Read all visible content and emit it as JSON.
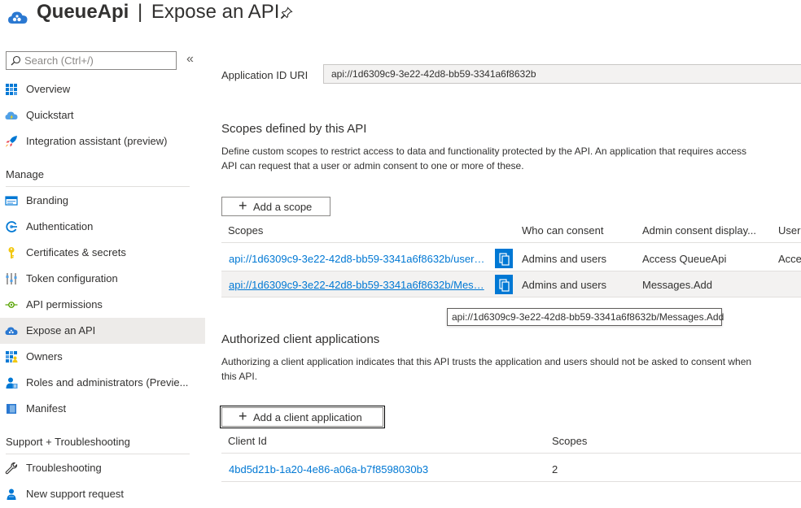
{
  "header": {
    "app_name": "QueueApi",
    "separator": "|",
    "page_title": "Expose an API"
  },
  "sidebar": {
    "search_placeholder": "Search (Ctrl+/)",
    "collapse_label": "«",
    "top_items": [
      {
        "label": "Overview",
        "icon": "overview-icon"
      },
      {
        "label": "Quickstart",
        "icon": "quickstart-icon"
      },
      {
        "label": "Integration assistant (preview)",
        "icon": "rocket-icon"
      }
    ],
    "manage_label": "Manage",
    "manage_items": [
      {
        "label": "Branding",
        "icon": "branding-icon"
      },
      {
        "label": "Authentication",
        "icon": "authentication-icon"
      },
      {
        "label": "Certificates & secrets",
        "icon": "key-icon"
      },
      {
        "label": "Token configuration",
        "icon": "token-config-icon"
      },
      {
        "label": "API permissions",
        "icon": "api-permissions-icon"
      },
      {
        "label": "Expose an API",
        "icon": "cloud-icon",
        "active": true
      },
      {
        "label": "Owners",
        "icon": "owners-icon"
      },
      {
        "label": "Roles and administrators (Previe...",
        "icon": "roles-icon"
      },
      {
        "label": "Manifest",
        "icon": "manifest-icon"
      }
    ],
    "support_label": "Support + Troubleshooting",
    "support_items": [
      {
        "label": "Troubleshooting",
        "icon": "wrench-icon"
      },
      {
        "label": "New support request",
        "icon": "support-person-icon"
      }
    ]
  },
  "main": {
    "appid_label": "Application ID URI",
    "appid_value": "api://1d6309c9-3e22-42d8-bb59-3341a6f8632b",
    "scopes_section": {
      "title": "Scopes defined by this API",
      "description_line1": "Define custom scopes to restrict access to data and functionality protected by the API. An application that requires access",
      "description_line2": "API can request that a user or admin consent to one or more of these.",
      "add_button": "Add a scope",
      "columns": [
        "Scopes",
        "Who can consent",
        "Admin consent display...",
        "User"
      ],
      "rows": [
        {
          "scope": "api://1d6309c9-3e22-42d8-bb59-3341a6f8632b/user…",
          "who": "Admins and users",
          "display": "Access QueueApi",
          "user": "Acce"
        },
        {
          "scope": "api://1d6309c9-3e22-42d8-bb59-3341a6f8632b/Mes…",
          "who": "Admins and users",
          "display": "Messages.Add",
          "user": ""
        }
      ]
    },
    "tooltip": "api://1d6309c9-3e22-42d8-bb59-3341a6f8632b/Messages.Add",
    "clients_section": {
      "title": "Authorized client applications",
      "description_line1": "Authorizing a client application indicates that this API trusts the application and users should not be asked to consent when",
      "description_line2": "this API.",
      "add_button": "Add a client application",
      "columns": [
        "Client Id",
        "Scopes"
      ],
      "rows": [
        {
          "client_id": "4bd5d21b-1a20-4e86-a06a-b7f8598030b3",
          "scopes": "2"
        }
      ]
    }
  },
  "colors": {
    "accent": "#0078d4",
    "active_bg": "#edebe9",
    "text": "#323130"
  }
}
